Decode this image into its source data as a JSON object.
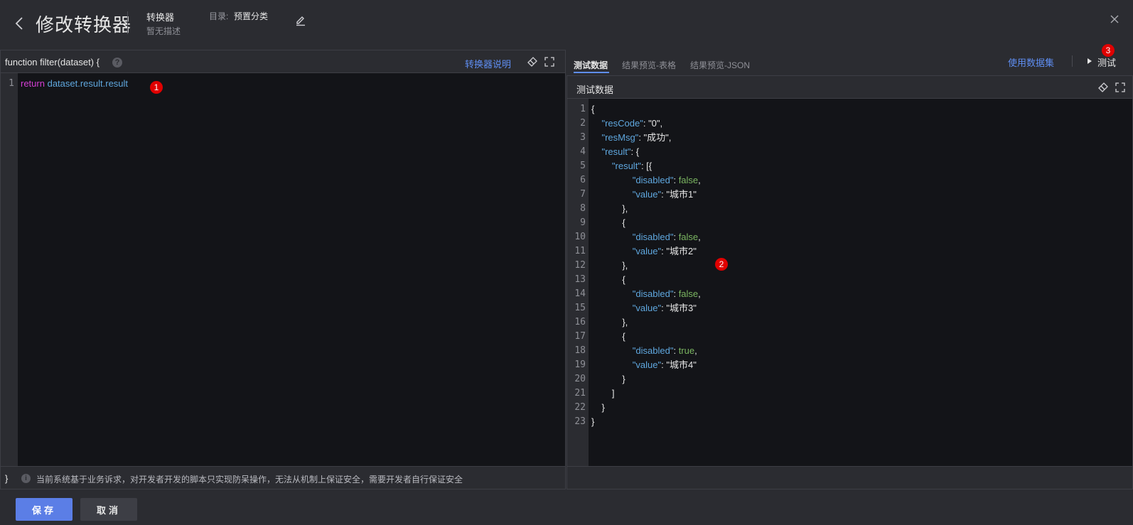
{
  "header": {
    "title": "修改转换器",
    "type_label": "转换器",
    "description": "暂无描述",
    "directory_label": "目录:",
    "directory_value": "预置分类"
  },
  "left": {
    "function_signature": "function filter(dataset) {",
    "help": "?",
    "doc_link": "转换器说明",
    "code_lines": [
      {
        "num": "1",
        "keyword": "return",
        "expr": "dataset.result.result"
      }
    ],
    "closing_brace": "}",
    "info": "i",
    "warning": "当前系统基于业务诉求，对开发者开发的脚本只实现防呆操作，无法从机制上保证安全，需要开发者自行保证安全"
  },
  "right": {
    "tabs": [
      {
        "label": "测试数据",
        "active": true
      },
      {
        "label": "结果预览-表格",
        "active": false
      },
      {
        "label": "结果预览-JSON",
        "active": false
      }
    ],
    "use_dataset_link": "使用数据集",
    "test_button": "测试",
    "panel_title": "测试数据",
    "json_lines": [
      {
        "n": "1",
        "ind": "",
        "k": "",
        "s": "{",
        "v": "",
        "t": ""
      },
      {
        "n": "2",
        "ind": "    ",
        "k": "\"resCode\"",
        "s": ": ",
        "v": "\"0\"",
        "t": ","
      },
      {
        "n": "3",
        "ind": "    ",
        "k": "\"resMsg\"",
        "s": ": ",
        "v": "\"成功\"",
        "t": ","
      },
      {
        "n": "4",
        "ind": "    ",
        "k": "\"result\"",
        "s": ": {",
        "v": "",
        "t": ""
      },
      {
        "n": "5",
        "ind": "        ",
        "k": "\"result\"",
        "s": ": [{",
        "v": "",
        "t": ""
      },
      {
        "n": "6",
        "ind": "                ",
        "k": "\"disabled\"",
        "s": ": ",
        "v": "false",
        "t": ",",
        "bool": true
      },
      {
        "n": "7",
        "ind": "                ",
        "k": "\"value\"",
        "s": ": ",
        "v": "\"城市1\"",
        "t": ""
      },
      {
        "n": "8",
        "ind": "            ",
        "k": "",
        "s": "},",
        "v": "",
        "t": ""
      },
      {
        "n": "9",
        "ind": "            ",
        "k": "",
        "s": "{",
        "v": "",
        "t": ""
      },
      {
        "n": "10",
        "ind": "                ",
        "k": "\"disabled\"",
        "s": ": ",
        "v": "false",
        "t": ",",
        "bool": true
      },
      {
        "n": "11",
        "ind": "                ",
        "k": "\"value\"",
        "s": ": ",
        "v": "\"城市2\"",
        "t": ""
      },
      {
        "n": "12",
        "ind": "            ",
        "k": "",
        "s": "},",
        "v": "",
        "t": ""
      },
      {
        "n": "13",
        "ind": "            ",
        "k": "",
        "s": "{",
        "v": "",
        "t": ""
      },
      {
        "n": "14",
        "ind": "                ",
        "k": "\"disabled\"",
        "s": ": ",
        "v": "false",
        "t": ",",
        "bool": true
      },
      {
        "n": "15",
        "ind": "                ",
        "k": "\"value\"",
        "s": ": ",
        "v": "\"城市3\"",
        "t": ""
      },
      {
        "n": "16",
        "ind": "            ",
        "k": "",
        "s": "},",
        "v": "",
        "t": ""
      },
      {
        "n": "17",
        "ind": "            ",
        "k": "",
        "s": "{",
        "v": "",
        "t": ""
      },
      {
        "n": "18",
        "ind": "                ",
        "k": "\"disabled\"",
        "s": ": ",
        "v": "true",
        "t": ",",
        "bool": true
      },
      {
        "n": "19",
        "ind": "                ",
        "k": "\"value\"",
        "s": ": ",
        "v": "\"城市4\"",
        "t": ""
      },
      {
        "n": "20",
        "ind": "            ",
        "k": "",
        "s": "}",
        "v": "",
        "t": ""
      },
      {
        "n": "21",
        "ind": "        ",
        "k": "",
        "s": "]",
        "v": "",
        "t": ""
      },
      {
        "n": "22",
        "ind": "    ",
        "k": "",
        "s": "}",
        "v": "",
        "t": ""
      },
      {
        "n": "23",
        "ind": "",
        "k": "",
        "s": "}",
        "v": "",
        "t": ""
      }
    ]
  },
  "annotations": [
    "1",
    "2",
    "3"
  ],
  "footer": {
    "save_label": "保存",
    "cancel_label": "取消"
  },
  "icons": {
    "back": "chevron-left-icon",
    "edit": "pencil-icon",
    "close": "close-icon",
    "format": "magic-wand-icon",
    "fullscreen": "fullscreen-icon",
    "play": "play-icon",
    "info": "info-icon",
    "help": "help-icon"
  },
  "colors": {
    "background": "#2b2c31",
    "editor": "#131418",
    "accent": "#5b7ee6",
    "link": "#5f8ef2",
    "keyword": "#d23ed3",
    "identifier": "#5fa7de",
    "boolean": "#7bb661",
    "badge": "#e00000"
  }
}
